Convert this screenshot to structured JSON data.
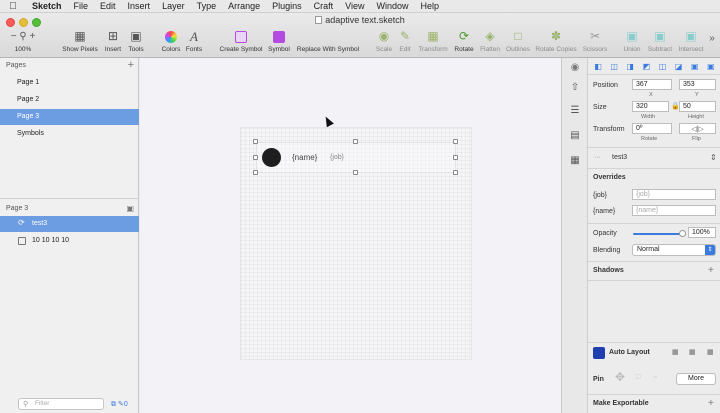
{
  "menubar": {
    "items": [
      "Sketch",
      "File",
      "Edit",
      "Insert",
      "Layer",
      "Type",
      "Arrange",
      "Plugins",
      "Craft",
      "View",
      "Window",
      "Help"
    ]
  },
  "window": {
    "title": "adaptive text.sketch"
  },
  "toolbar": {
    "zoom": "100%",
    "zoom_minus": "−",
    "zoom_plus": "+",
    "show_pixels": "Show Pixels",
    "insert": "Insert",
    "tools": "Tools",
    "colors": "Colors",
    "fonts": "Fonts",
    "create_symbol": "Create Symbol",
    "symbol": "Symbol",
    "replace_with_symbol": "Replace With Symbol",
    "scale": "Scale",
    "edit": "Edit",
    "transform": "Transform",
    "rotate": "Rotate",
    "flatten": "Flatten",
    "outlines": "Outlines",
    "rotate_copies": "Rotate Copies",
    "scissors": "Scissors",
    "union": "Union",
    "subtract": "Subtract",
    "intersect": "Intersect",
    "more": "»"
  },
  "pages": {
    "header": "Pages",
    "add": "+",
    "items": [
      {
        "label": "Page 1",
        "selected": false
      },
      {
        "label": "Page 2",
        "selected": false
      },
      {
        "label": "Page 3",
        "selected": true
      },
      {
        "label": "Symbols",
        "selected": false
      }
    ]
  },
  "layers": {
    "header": "Page 3",
    "items": [
      {
        "label": "test3",
        "selected": true
      },
      {
        "label": "10 10 10 10",
        "selected": false
      }
    ],
    "filter_placeholder": "Filter",
    "badge_count": "0"
  },
  "canvas": {
    "symbol_name_text": "{name}",
    "symbol_job_text": "{job}"
  },
  "inspector": {
    "position_label": "Position",
    "x_value": "367",
    "y_value": "353",
    "x_label": "X",
    "y_label": "Y",
    "size_label": "Size",
    "width_value": "320",
    "height_value": "50",
    "width_label": "Width",
    "height_label": "Height",
    "transform_label": "Transform",
    "rotate_value": "0º",
    "rotate_label": "Rotate",
    "flip_label": "Flip",
    "symbol_name": "test3",
    "overrides_label": "Overrides",
    "override_job_label": "{job}",
    "override_job_placeholder": "{job}",
    "override_name_label": "{name}",
    "override_name_placeholder": "{name}",
    "opacity_label": "Opacity",
    "opacity_value": "100%",
    "opacity_level": 1.0,
    "blending_label": "Blending",
    "blending_value": "Normal",
    "shadows_label": "Shadows",
    "autolayout_label": "Auto Layout",
    "pin_label": "Pin",
    "more_button": "More",
    "make_exportable": "Make Exportable"
  },
  "colors": {
    "selection": "#6c9ce2",
    "accent": "#3a7be0",
    "symbol_purple": "#b44be1",
    "canvas_bg": "#f2f2f7"
  }
}
